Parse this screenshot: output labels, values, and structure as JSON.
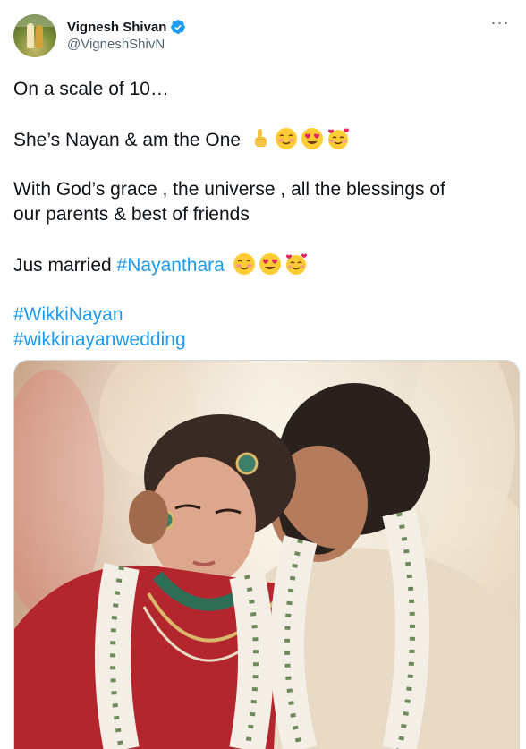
{
  "author": {
    "display_name": "Vignesh Shivan",
    "handle": "@VigneshShivN",
    "verified": true,
    "avatar_icon": "profile-photo"
  },
  "more_icon": "more-horizontal-icon",
  "tweet": {
    "line1": "On a scale of 10…",
    "line2": "She’s Nayan & am the One",
    "line3a": "With God’s grace , the universe , all the blessings of",
    "line3b": "our parents & best of friends",
    "line4": "Jus married",
    "hashtag_inline": "#Nayanthara",
    "hashtag2": "#WikkiNayan",
    "hashtag3": "#wikkinayanwedding"
  },
  "colors": {
    "link": "#1d9bf0",
    "text": "#0f1419",
    "secondary": "#536471"
  },
  "media": {
    "type": "photo"
  }
}
